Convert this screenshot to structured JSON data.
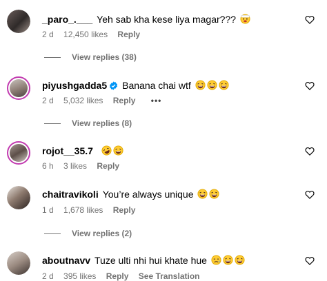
{
  "comments": [
    {
      "username": "_paro_.___",
      "text": "Yeh sab kha kese liya magar???",
      "emoji": [
        "face-with-head-bandage"
      ],
      "age": "2 d",
      "likes": "12,450 likes",
      "reply_label": "Reply",
      "view_replies": "View replies (38)"
    },
    {
      "username": "piyushgadda5",
      "verified": true,
      "text": "Banana chai wtf",
      "emoji": [
        "laughing",
        "laughing",
        "laughing"
      ],
      "age": "2 d",
      "likes": "5,032 likes",
      "reply_label": "Reply",
      "more": "•••",
      "view_replies": "View replies (8)"
    },
    {
      "username": "rojot__35.7",
      "text": "",
      "emoji": [
        "rofl",
        "laughing"
      ],
      "age": "6 h",
      "likes": "3 likes",
      "reply_label": "Reply"
    },
    {
      "username": "chaitravikoli",
      "text": "You’re always unique",
      "emoji": [
        "laughing",
        "laughing"
      ],
      "age": "1 d",
      "likes": "1,678 likes",
      "reply_label": "Reply",
      "view_replies": "View replies (2)"
    },
    {
      "username": "aboutnavv",
      "text": "Tuze ulti nhi hui khate hue",
      "emoji": [
        "crying-sweat",
        "laughing",
        "laughing"
      ],
      "age": "2 d",
      "likes": "395 likes",
      "reply_label": "Reply",
      "see_translation": "See Translation"
    }
  ],
  "colors": {
    "meta": "#737373",
    "ring": "#c23bb0",
    "verified": "#0095f6",
    "emoji_face": "#ffcc33"
  }
}
